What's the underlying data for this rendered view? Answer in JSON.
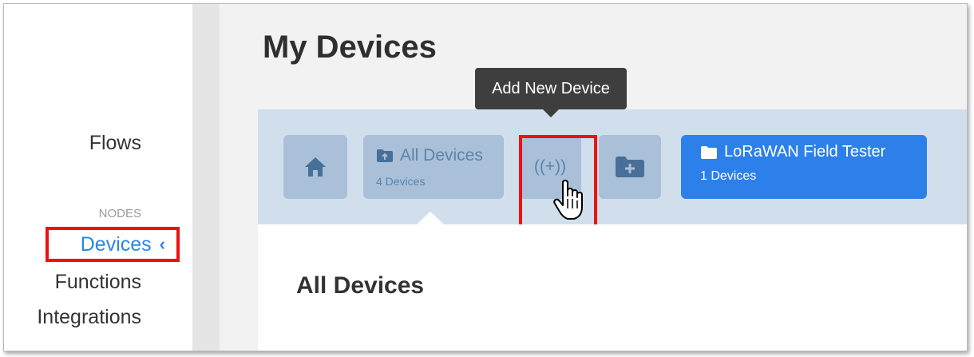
{
  "sidebar": {
    "flows_label": "Flows",
    "section_label": "NODES",
    "devices_label": "Devices",
    "functions_label": "Functions",
    "integrations_label": "Integrations"
  },
  "main": {
    "title": "My Devices",
    "tooltip": "Add New Device",
    "toolbar": {
      "all_devices_label": "All Devices",
      "all_devices_count": "4 Devices",
      "add_device_glyph": "((+))",
      "folder_label": "LoRaWAN Field Tester",
      "folder_count": "1 Devices"
    },
    "section_title": "All Devices"
  },
  "colors": {
    "accent": "#2d80ea",
    "toolbar_bg": "#d1dfed",
    "button_bg": "#a9c0d8",
    "highlight": "#ee1111",
    "tooltip_bg": "#3e3e3e"
  },
  "icons": [
    "home-icon",
    "folder-icon",
    "add-device-icon",
    "new-folder-icon",
    "chevron-left-icon",
    "hand-cursor-icon"
  ]
}
